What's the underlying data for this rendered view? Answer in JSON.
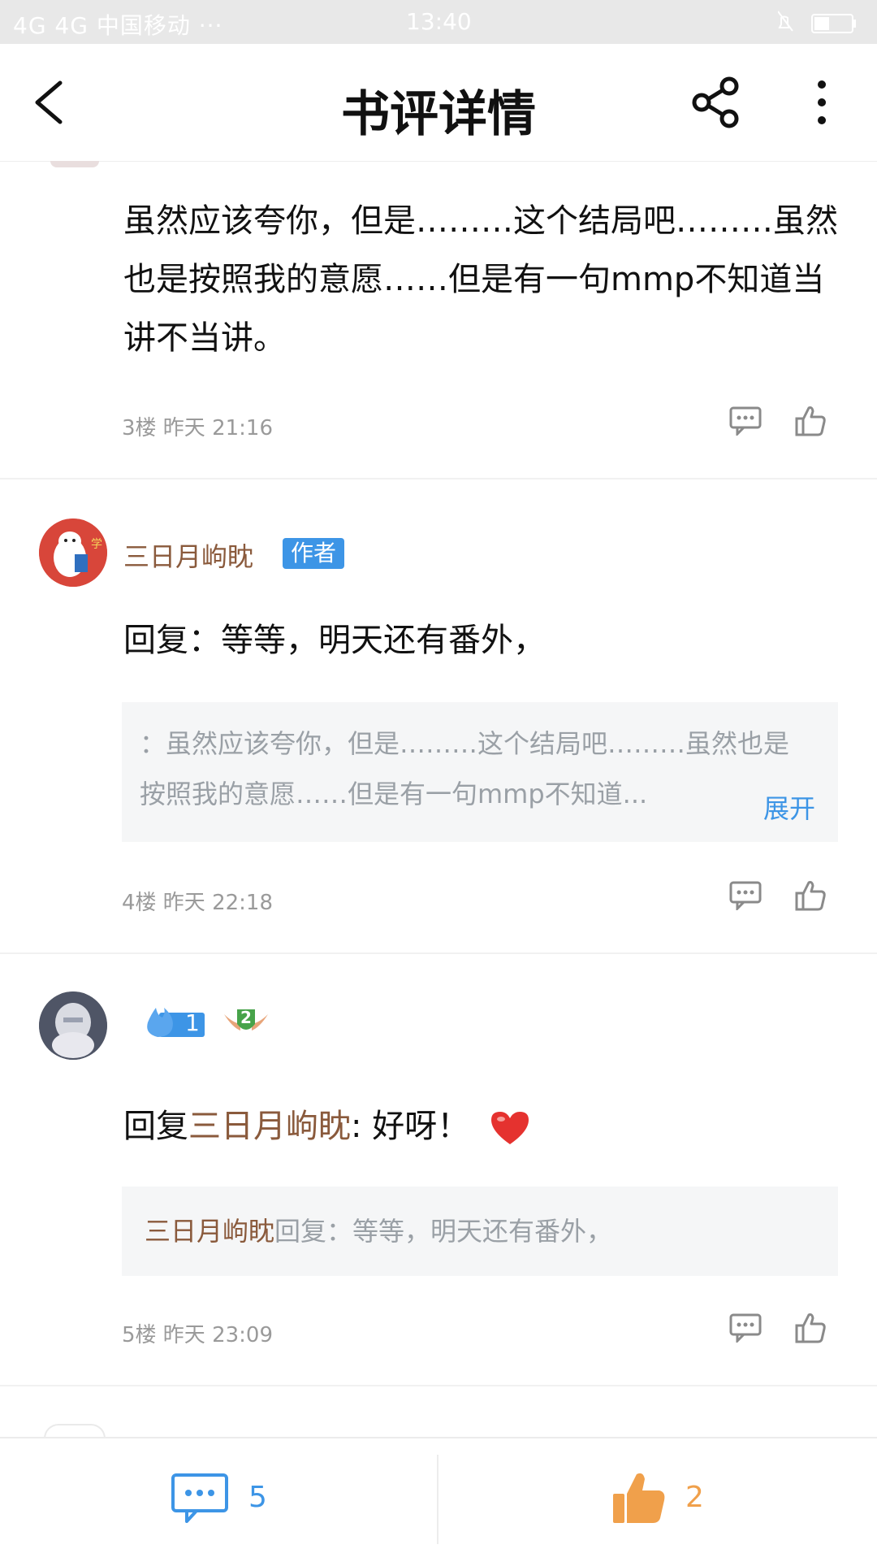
{
  "status_bar": {
    "carrier": "4G 4G 中国移动 ···",
    "time": "13:40"
  },
  "nav": {
    "title": "书评详情",
    "back_icon": "chevron-left-icon",
    "share_icon": "share-icon",
    "more_icon": "more-vertical-icon"
  },
  "comments": [
    {
      "text": "虽然应该夸你，但是………这个结局吧………虽然也是按照我的意愿……但是有一句mmp不知道当讲不当讲。",
      "meta": "3楼 昨天 21:16"
    },
    {
      "username": "三日月岣眈",
      "badge": "作者",
      "text": "回复：等等，明天还有番外，",
      "quote": "：虽然应该夸你，但是………这个结局吧………虽然也是按照我的意愿……但是有一句mmp不知道...",
      "expand": "展开",
      "meta": "4楼 昨天 22:18"
    },
    {
      "fire_level": "1",
      "medal_level": "2",
      "reply_prefix": "回复",
      "reply_user": "三日月岣眈",
      "reply_text": ": 好呀！",
      "quote_user": "三日月岣眈",
      "quote_text": "回复：等等，明天还有番外，",
      "meta": "5楼 昨天 23:09"
    }
  ],
  "bottom": {
    "comment_count": "5",
    "like_count": "2"
  },
  "colors": {
    "accent_blue": "#3d95e6",
    "like_orange": "#f0a04b",
    "username_brown": "#8a5a3c"
  }
}
